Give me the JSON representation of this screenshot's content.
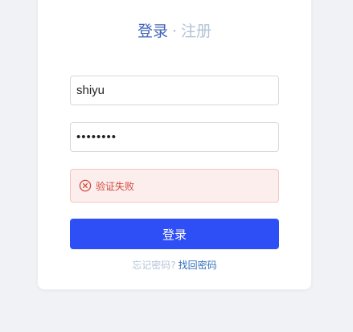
{
  "tabs": {
    "login": "登录",
    "separator": "·",
    "register": "注册"
  },
  "form": {
    "username_value": "shiyu",
    "password_value": "••••••••"
  },
  "alert": {
    "icon": "close-circle-icon",
    "message": "验证失败",
    "color": "#d04a3c"
  },
  "submit": {
    "label": "登录",
    "color": "#2e4ef6"
  },
  "forgot": {
    "text": "忘记密码?",
    "link": "找回密码"
  }
}
